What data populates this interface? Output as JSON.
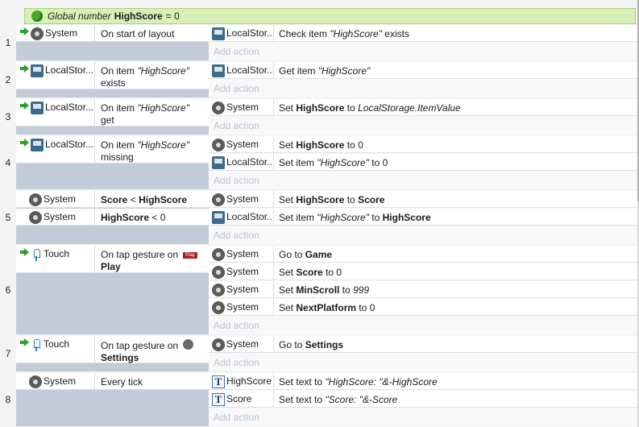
{
  "global_var": {
    "prefix": "Global number",
    "name": "HighScore",
    "suffix": "= 0"
  },
  "add_action_label": "Add action",
  "events": [
    {
      "num": "1",
      "conditions": [
        {
          "object": "System",
          "icon": "gear-icon",
          "trigger": true,
          "text": "On start of layout"
        }
      ],
      "actions": [
        {
          "object": "LocalStor...",
          "icon": "local-storage-icon",
          "text": "Check item \"HighScore\" exists"
        }
      ]
    },
    {
      "num": "2",
      "conditions": [
        {
          "object": "LocalStor...",
          "icon": "local-storage-icon",
          "trigger": true,
          "text": "On item \"HighScore\"",
          "text2": "exists"
        }
      ],
      "actions": [
        {
          "object": "LocalStor...",
          "icon": "local-storage-icon",
          "text": "Get item \"HighScore\""
        }
      ]
    },
    {
      "num": "3",
      "conditions": [
        {
          "object": "LocalStor...",
          "icon": "local-storage-icon",
          "trigger": true,
          "text": "On item \"HighScore\"",
          "text2": "get"
        }
      ],
      "actions": [
        {
          "object": "System",
          "icon": "gear-icon",
          "text": "Set HighScore to LocalStorage.ItemValue"
        }
      ]
    },
    {
      "num": "4",
      "conditions": [
        {
          "object": "LocalStor...",
          "icon": "local-storage-icon",
          "trigger": true,
          "text": "On item \"HighScore\"",
          "text2": "missing"
        }
      ],
      "actions": [
        {
          "object": "System",
          "icon": "gear-icon",
          "text": "Set HighScore to 0"
        },
        {
          "object": "LocalStor...",
          "icon": "local-storage-icon",
          "text": "Set item \"HighScore\" to 0"
        }
      ]
    },
    {
      "num": "5",
      "conditions": [
        {
          "object": "System",
          "icon": "gear-icon",
          "trigger": false,
          "text": "Score < HighScore"
        },
        {
          "object": "System",
          "icon": "gear-icon",
          "trigger": false,
          "text": "HighScore < 0"
        }
      ],
      "actions": [
        {
          "object": "System",
          "icon": "gear-icon",
          "text": "Set HighScore to Score"
        },
        {
          "object": "LocalStor...",
          "icon": "local-storage-icon",
          "text": "Set item \"HighScore\" to HighScore"
        }
      ]
    },
    {
      "num": "6",
      "conditions": [
        {
          "object": "Touch",
          "icon": "touch-icon",
          "trigger": true,
          "text": "On tap gesture on",
          "text2": "Play",
          "badge": "Play"
        }
      ],
      "actions": [
        {
          "object": "System",
          "icon": "gear-icon",
          "text": "Go to Game"
        },
        {
          "object": "System",
          "icon": "gear-icon",
          "text": "Set Score to 0"
        },
        {
          "object": "System",
          "icon": "gear-icon",
          "text": "Set MinScroll to 999"
        },
        {
          "object": "System",
          "icon": "gear-icon",
          "text": "Set NextPlatform to 0"
        }
      ]
    },
    {
      "num": "7",
      "conditions": [
        {
          "object": "Touch",
          "icon": "touch-icon",
          "trigger": true,
          "text": "On tap gesture on",
          "text2": "Settings",
          "gearbadge": true
        }
      ],
      "actions": [
        {
          "object": "System",
          "icon": "gear-icon",
          "text": "Go to Settings"
        }
      ]
    },
    {
      "num": "8",
      "conditions": [
        {
          "object": "System",
          "icon": "gear-icon",
          "trigger": false,
          "text": "Every tick"
        }
      ],
      "actions": [
        {
          "object": "HighScore",
          "icon": "text-object-icon",
          "text": "Set text to \"HighScore: \"&-HighScore"
        },
        {
          "object": "Score",
          "icon": "text-object-icon",
          "text": "Set text to \"Score: \"&-Score"
        }
      ]
    }
  ]
}
